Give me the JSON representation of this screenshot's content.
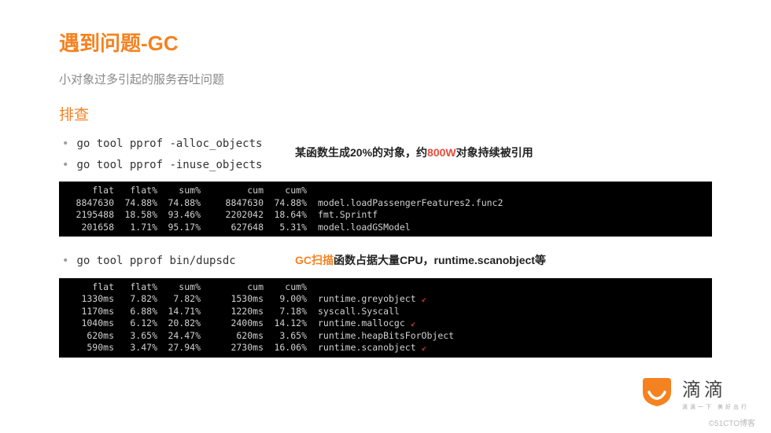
{
  "title": "遇到问题-GC",
  "subtitle": "小对象过多引起的服务吞吐问题",
  "section": "排查",
  "bullets1": [
    "go tool pprof -alloc_objects",
    "go tool pprof -inuse_objects"
  ],
  "annotation1": {
    "prefix": "某函数生成20%的对象，约",
    "highlight": "800W",
    "suffix": "对象持续被引用"
  },
  "bullets2": [
    "go tool pprof bin/dupsdc"
  ],
  "annotation2": {
    "highlight": "GC扫描",
    "suffix": "函数占据大量CPU，runtime.scanobject等"
  },
  "table1": {
    "headers": [
      "flat",
      "flat%",
      "sum%",
      "cum",
      "cum%",
      ""
    ],
    "rows": [
      [
        "8847630",
        "74.88%",
        "74.88%",
        "8847630",
        "74.88%",
        "model.loadPassengerFeatures2.func2"
      ],
      [
        "2195488",
        "18.58%",
        "93.46%",
        "2202042",
        "18.64%",
        "fmt.Sprintf"
      ],
      [
        "201658",
        "1.71%",
        "95.17%",
        "627648",
        "5.31%",
        "model.loadGSModel"
      ]
    ]
  },
  "table2": {
    "headers": [
      "flat",
      "flat%",
      "sum%",
      "cum",
      "cum%",
      ""
    ],
    "rows": [
      [
        "1330ms",
        "7.82%",
        "7.82%",
        "1530ms",
        "9.00%",
        "runtime.greyobject",
        true
      ],
      [
        "1170ms",
        "6.88%",
        "14.71%",
        "1220ms",
        "7.18%",
        "syscall.Syscall",
        false
      ],
      [
        "1040ms",
        "6.12%",
        "20.82%",
        "2400ms",
        "14.12%",
        "runtime.mallocgc",
        true
      ],
      [
        "620ms",
        "3.65%",
        "24.47%",
        "620ms",
        "3.65%",
        "runtime.heapBitsForObject",
        false
      ],
      [
        "590ms",
        "3.47%",
        "27.94%",
        "2730ms",
        "16.06%",
        "runtime.scanobject",
        true
      ]
    ]
  },
  "logo": {
    "name": "滴滴",
    "tagline": "滴滴一下 美好出行"
  },
  "watermark": "©51CTO博客"
}
